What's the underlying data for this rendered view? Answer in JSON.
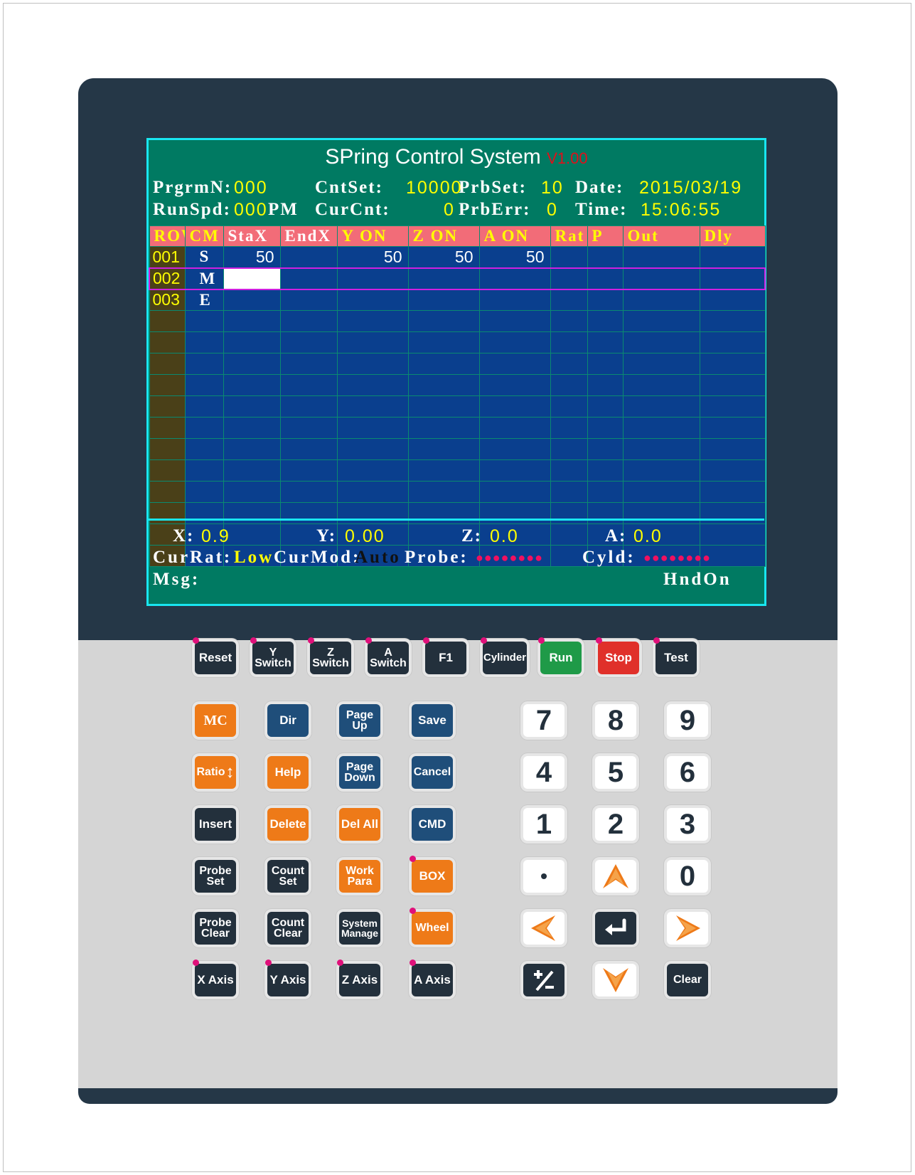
{
  "screen": {
    "title": "SPring Control System",
    "version": "V1.00",
    "info": {
      "prgrm_label": "PrgrmN:",
      "prgrm_value": "000",
      "cntset_label": "CntSet:",
      "cntset_value": "10000",
      "prbset_label": "PrbSet:",
      "prbset_value": "10",
      "date_label": "Date:",
      "date_value": "2015/03/19",
      "runspd_label": "RunSpd:",
      "runspd_value": "000",
      "runspd_unit": "PM",
      "curcnt_label": "CurCnt:",
      "curcnt_value": "0",
      "prberr_label": "PrbErr:",
      "prberr_value": "0",
      "time_label": "Time:",
      "time_value": "15:06:55"
    },
    "columns": [
      "ROW",
      "CM",
      "StaX",
      "EndX",
      "Y ON",
      "Z ON",
      "A ON",
      "Rat",
      "P",
      "Out",
      "Dly"
    ],
    "rows": [
      {
        "row": "001",
        "cm": "S",
        "stax": "50",
        "endx": "",
        "yon": "50",
        "zon": "50",
        "aon": "50",
        "rat": "",
        "p": "",
        "out": "",
        "dly": ""
      },
      {
        "row": "002",
        "cm": "M",
        "stax": "",
        "endx": "",
        "yon": "",
        "zon": "",
        "aon": "",
        "rat": "",
        "p": "",
        "out": "",
        "dly": ""
      },
      {
        "row": "003",
        "cm": "E",
        "stax": "",
        "endx": "",
        "yon": "",
        "zon": "",
        "aon": "",
        "rat": "",
        "p": "",
        "out": "",
        "dly": ""
      }
    ],
    "axes": {
      "x_label": "X:",
      "x_value": "0.9",
      "y_label": "Y:",
      "y_value": "0.00",
      "z_label": "Z:",
      "z_value": "0.0",
      "a_label": "A:",
      "a_value": "0.0"
    },
    "status": {
      "currat_label": "CurRat:",
      "currat_value": "Low",
      "curmod_label": "CurMod:",
      "curmod_value": "Auto",
      "probe_label": "Probe:",
      "probe_dots": "●●●●●●●●",
      "cyld_label": "Cyld:",
      "cyld_dots": "●●●●●●●●",
      "msg_label": "Msg:",
      "hnd_label": "HndOn"
    }
  },
  "keys": {
    "reset": "Reset",
    "y_switch_1": "Y",
    "y_switch_2": "Switch",
    "z_switch_1": "Z",
    "z_switch_2": "Switch",
    "a_switch_1": "A",
    "a_switch_2": "Switch",
    "f1": "F1",
    "cylinder": "Cylinder",
    "run": "Run",
    "stop": "Stop",
    "test": "Test",
    "mc": "MC",
    "dir": "Dir",
    "page_up_1": "Page",
    "page_up_2": "Up",
    "save": "Save",
    "ratio": "Ratio",
    "help": "Help",
    "page_down_1": "Page",
    "page_down_2": "Down",
    "cancel": "Cancel",
    "insert": "Insert",
    "delete": "Delete",
    "del_all": "Del All",
    "cmd": "CMD",
    "probe_set_1": "Probe",
    "probe_set_2": "Set",
    "count_set_1": "Count",
    "count_set_2": "Set",
    "work_para_1": "Work",
    "work_para_2": "Para",
    "box": "BOX",
    "probe_clear_1": "Probe",
    "probe_clear_2": "Clear",
    "count_clear_1": "Count",
    "count_clear_2": "Clear",
    "system_manage_1": "System",
    "system_manage_2": "Manage",
    "wheel": "Wheel",
    "x_axis": "X Axis",
    "y_axis": "Y Axis",
    "z_axis": "Z Axis",
    "a_axis": "A Axis",
    "n7": "7",
    "n8": "8",
    "n9": "9",
    "n4": "4",
    "n5": "5",
    "n6": "6",
    "n1": "1",
    "n2": "2",
    "n3": "3",
    "dot": "•",
    "n0": "0",
    "clear": "Clear"
  },
  "colors": {
    "screen_bg": "#007a62",
    "grid_bg": "#0a3f8e",
    "header_bg": "#f26c78",
    "accent_cyan": "#19e6f0"
  }
}
